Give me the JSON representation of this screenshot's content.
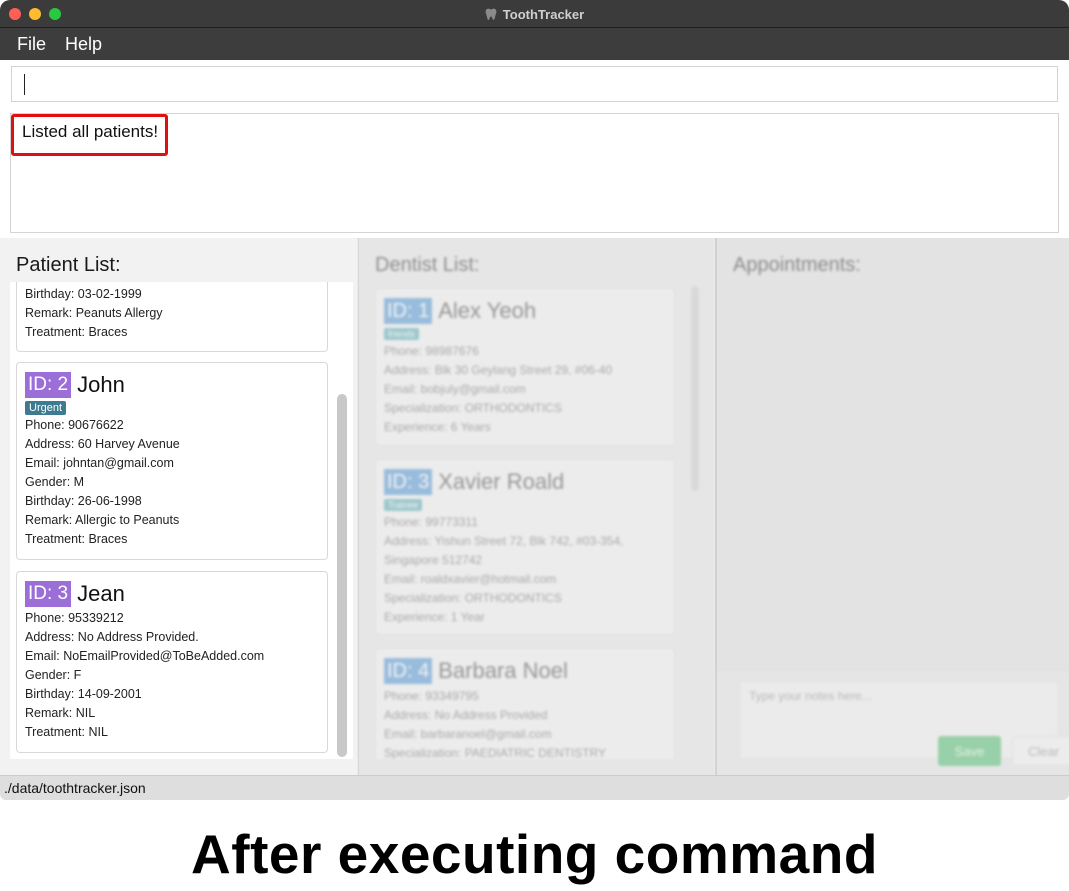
{
  "window": {
    "title": "ToothTracker"
  },
  "menu": {
    "items": [
      "File",
      "Help"
    ]
  },
  "command": {
    "value": ""
  },
  "result": {
    "text": "Listed all patients!"
  },
  "patients": {
    "title": "Patient List:",
    "partial_card": {
      "lines": [
        "Birthday: 03-02-1999",
        "Remark: Peanuts Allergy",
        "Treatment: Braces"
      ]
    },
    "cards": [
      {
        "id": "ID: 2",
        "name": "John",
        "tag": "Urgent",
        "lines": [
          "Phone: 90676622",
          "Address: 60 Harvey Avenue",
          "Email: johntan@gmail.com",
          "Gender: M",
          "Birthday: 26-06-1998",
          "Remark: Allergic to Peanuts",
          "Treatment: Braces"
        ]
      },
      {
        "id": "ID: 3",
        "name": "Jean",
        "tag": "",
        "lines": [
          "Phone: 95339212",
          "Address: No Address Provided.",
          "Email: NoEmailProvided@ToBeAdded.com",
          "Gender: F",
          "Birthday: 14-09-2001",
          "Remark: NIL",
          "Treatment: NIL"
        ]
      }
    ]
  },
  "dentists": {
    "title": "Dentist List:",
    "cards": [
      {
        "id": "ID: 1",
        "name": "Alex Yeoh",
        "tag": "friends",
        "lines": [
          "Phone: 98987676",
          "Address: Blk 30 Geylang Street 29, #06-40",
          "Email: bobjuly@gmail.com",
          "Specialization: ORTHODONTICS",
          "Experience: 6 Years"
        ]
      },
      {
        "id": "ID: 3",
        "name": "Xavier Roald",
        "tag": "Trainee",
        "lines": [
          "Phone: 99773311",
          "Address: Yishun Street 72, Blk 742, #03-354,",
          "Singapore 512742",
          "Email: roaldxavier@hotmail.com",
          "Specialization: ORTHODONTICS",
          "Experience: 1 Year"
        ]
      },
      {
        "id": "ID: 4",
        "name": "Barbara Noel",
        "tag": "",
        "lines": [
          "Phone: 93349795",
          "Address: No Address Provided",
          "Email: barbaranoel@gmail.com",
          "Specialization: PAEDIATRIC DENTISTRY"
        ]
      }
    ]
  },
  "appointments": {
    "title": "Appointments:",
    "notes_placeholder": "Type your notes here...",
    "save_label": "Save",
    "clear_label": "Clear"
  },
  "status": {
    "path": "./data/toothtracker.json"
  },
  "caption": "After executing command",
  "colors": {
    "patient_id_badge": "#9b6ed8",
    "urgent_tag": "#3e7b91",
    "dentist_id_badge": "#5a9bd6",
    "highlight_border": "#e01010",
    "save_button": "#5cc27a"
  }
}
